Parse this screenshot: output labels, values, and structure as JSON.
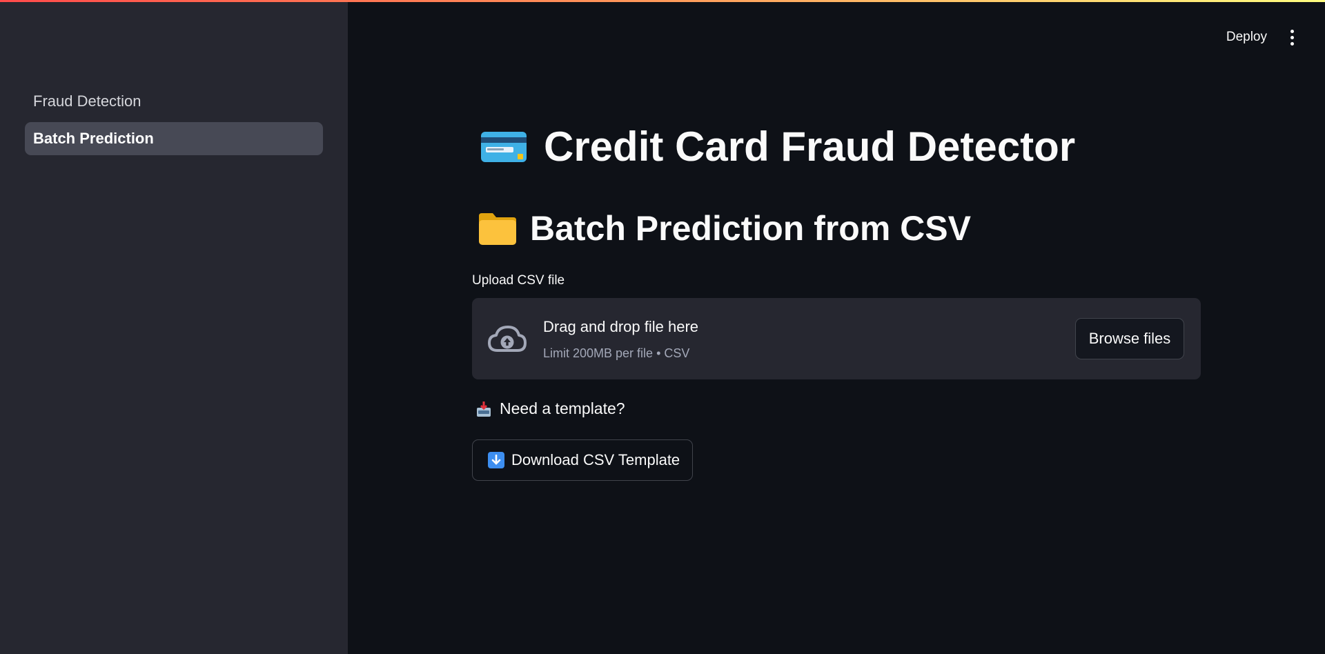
{
  "sidebar": {
    "items": [
      {
        "label": "Fraud Detection",
        "active": false
      },
      {
        "label": "Batch Prediction",
        "active": true
      }
    ]
  },
  "header": {
    "deploy_label": "Deploy",
    "menu_icon": "kebab-menu-icon"
  },
  "main": {
    "title": "Credit Card Fraud Detector",
    "title_icon": "credit-card-icon",
    "subtitle": "Batch Prediction from CSV",
    "subtitle_icon": "folder-icon",
    "uploader": {
      "label": "Upload CSV file",
      "drop_text": "Drag and drop file here",
      "limit_text": "Limit 200MB per file • CSV",
      "browse_label": "Browse files",
      "icon": "cloud-upload-icon"
    },
    "template_prompt": "Need a template?",
    "template_icon": "inbox-tray-icon",
    "download_label": "Download CSV Template",
    "download_icon": "down-arrow-icon"
  },
  "colors": {
    "background": "#0e1117",
    "sidebar": "#262730",
    "active_item": "#474955",
    "dropzone": "#262730",
    "accent_gradient": [
      "#ff4b4b",
      "#fffd80"
    ]
  }
}
